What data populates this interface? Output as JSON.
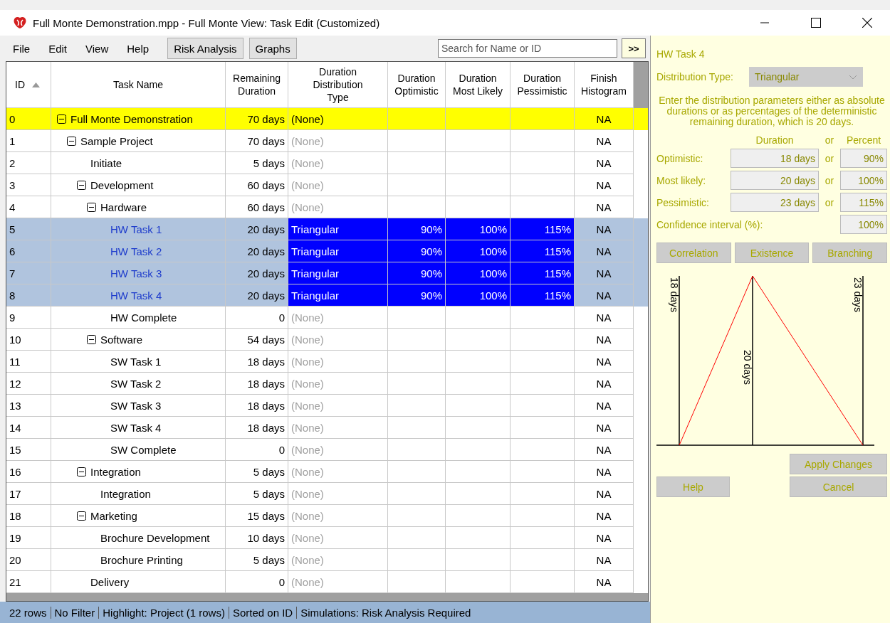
{
  "window": {
    "title": "Full Monte Demonstration.mpp - Full Monte View: Task Edit (Customized)"
  },
  "menu": [
    {
      "label": "File",
      "kind": "menu"
    },
    {
      "label": "Edit",
      "kind": "menu"
    },
    {
      "label": "View",
      "kind": "menu"
    },
    {
      "label": "Help",
      "kind": "menu"
    },
    {
      "label": "Risk Analysis",
      "kind": "button"
    },
    {
      "label": "Graphs",
      "kind": "button"
    }
  ],
  "search": {
    "placeholder": "Search for Name or ID"
  },
  "toggle_button": ">>",
  "table": {
    "columns": [
      {
        "label": "ID",
        "sorted": true
      },
      {
        "label": "Task Name",
        "sorted": false
      },
      {
        "label": "Remaining Duration",
        "sorted": false
      },
      {
        "label": "Duration Distribution Type",
        "sorted": false
      },
      {
        "label": "Duration Optimistic",
        "sorted": false
      },
      {
        "label": "Duration Most Likely",
        "sorted": false
      },
      {
        "label": "Duration Pessimistic",
        "sorted": false
      },
      {
        "label": "Finish Histogram",
        "sorted": false
      }
    ],
    "rows": [
      {
        "id": "0",
        "name": "Full Monte Demonstration",
        "remaining": "70 days",
        "distribution": "(None)",
        "dist_greyed": false,
        "optimistic": "",
        "likely": "",
        "pessimistic": "",
        "finish": "NA",
        "highlighted": true,
        "selected": false,
        "expanded": true,
        "children": [
          {
            "id": "1",
            "name": "Sample Project",
            "remaining": "70 days",
            "distribution": "(None)",
            "dist_greyed": true,
            "finish": "NA",
            "highlighted": false,
            "selected": false,
            "expanded": true,
            "children": [
              {
                "id": "2",
                "name": "Initiate",
                "remaining": "5 days",
                "distribution": "(None)",
                "dist_greyed": true,
                "finish": "NA",
                "highlighted": false,
                "selected": false
              },
              {
                "id": "3",
                "name": "Development",
                "remaining": "60 days",
                "distribution": "(None)",
                "dist_greyed": true,
                "finish": "NA",
                "highlighted": false,
                "selected": false,
                "expanded": true,
                "children": [
                  {
                    "id": "4",
                    "name": "Hardware",
                    "remaining": "60 days",
                    "distribution": "(None)",
                    "dist_greyed": true,
                    "finish": "NA",
                    "highlighted": false,
                    "selected": false,
                    "expanded": true,
                    "children": [
                      {
                        "id": "5",
                        "name": "HW Task 1",
                        "remaining": "20 days",
                        "distribution": "Triangular",
                        "optimistic": "90%",
                        "likely": "100%",
                        "pessimistic": "115%",
                        "finish": "NA",
                        "highlighted": false,
                        "selected": true
                      },
                      {
                        "id": "6",
                        "name": "HW Task 2",
                        "remaining": "20 days",
                        "distribution": "Triangular",
                        "optimistic": "90%",
                        "likely": "100%",
                        "pessimistic": "115%",
                        "finish": "NA",
                        "highlighted": false,
                        "selected": true
                      },
                      {
                        "id": "7",
                        "name": "HW Task 3",
                        "remaining": "20 days",
                        "distribution": "Triangular",
                        "optimistic": "90%",
                        "likely": "100%",
                        "pessimistic": "115%",
                        "finish": "NA",
                        "highlighted": false,
                        "selected": true
                      },
                      {
                        "id": "8",
                        "name": "HW Task 4",
                        "remaining": "20 days",
                        "distribution": "Triangular",
                        "optimistic": "90%",
                        "likely": "100%",
                        "pessimistic": "115%",
                        "finish": "NA",
                        "highlighted": false,
                        "selected": true
                      },
                      {
                        "id": "9",
                        "name": "HW Complete",
                        "remaining": "0",
                        "distribution": "(None)",
                        "dist_greyed": true,
                        "finish": "NA",
                        "highlighted": false,
                        "selected": false
                      }
                    ]
                  },
                  {
                    "id": "10",
                    "name": "Software",
                    "remaining": "54 days",
                    "distribution": "(None)",
                    "dist_greyed": true,
                    "finish": "NA",
                    "highlighted": false,
                    "selected": false,
                    "expanded": true,
                    "children": [
                      {
                        "id": "11",
                        "name": "SW Task 1",
                        "remaining": "18 days",
                        "distribution": "(None)",
                        "dist_greyed": true,
                        "finish": "NA",
                        "highlighted": false,
                        "selected": false
                      },
                      {
                        "id": "12",
                        "name": "SW Task 2",
                        "remaining": "18 days",
                        "distribution": "(None)",
                        "dist_greyed": true,
                        "finish": "NA",
                        "highlighted": false,
                        "selected": false
                      },
                      {
                        "id": "13",
                        "name": "SW Task 3",
                        "remaining": "18 days",
                        "distribution": "(None)",
                        "dist_greyed": true,
                        "finish": "NA",
                        "highlighted": false,
                        "selected": false
                      },
                      {
                        "id": "14",
                        "name": "SW Task 4",
                        "remaining": "18 days",
                        "distribution": "(None)",
                        "dist_greyed": true,
                        "finish": "NA",
                        "highlighted": false,
                        "selected": false
                      },
                      {
                        "id": "15",
                        "name": "SW Complete",
                        "remaining": "0",
                        "distribution": "(None)",
                        "dist_greyed": true,
                        "finish": "NA",
                        "highlighted": false,
                        "selected": false
                      }
                    ]
                  }
                ]
              },
              {
                "id": "16",
                "name": "Integration",
                "remaining": "5 days",
                "distribution": "(None)",
                "dist_greyed": true,
                "finish": "NA",
                "highlighted": false,
                "selected": false,
                "expanded": true,
                "children": [
                  {
                    "id": "17",
                    "name": "Integration",
                    "remaining": "5 days",
                    "distribution": "(None)",
                    "dist_greyed": true,
                    "finish": "NA",
                    "highlighted": false,
                    "selected": false
                  }
                ]
              },
              {
                "id": "18",
                "name": "Marketing",
                "remaining": "15 days",
                "distribution": "(None)",
                "dist_greyed": true,
                "finish": "NA",
                "highlighted": false,
                "selected": false,
                "expanded": true,
                "children": [
                  {
                    "id": "19",
                    "name": "Brochure Development",
                    "remaining": "10 days",
                    "distribution": "(None)",
                    "dist_greyed": true,
                    "finish": "NA",
                    "highlighted": false,
                    "selected": false
                  },
                  {
                    "id": "20",
                    "name": "Brochure Printing",
                    "remaining": "5 days",
                    "distribution": "(None)",
                    "dist_greyed": true,
                    "finish": "NA",
                    "highlighted": false,
                    "selected": false
                  }
                ]
              },
              {
                "id": "21",
                "name": "Delivery",
                "remaining": "0",
                "distribution": "(None)",
                "dist_greyed": true,
                "finish": "NA",
                "highlighted": false,
                "selected": false
              }
            ]
          }
        ]
      }
    ]
  },
  "status_bar": [
    "22 rows",
    "No Filter",
    "Highlight: Project (1 rows)",
    "Sorted on ID",
    "Simulations: Risk Analysis Required"
  ],
  "panel": {
    "task": "HW Task 4",
    "distribution_label": "Distribution Type:",
    "distribution_value": "Triangular",
    "instructions": "Enter the distribution parameters either as absolute durations or as percentages of the deterministic remaining duration, which is 20 days.",
    "duration_heading": "Duration",
    "or_heading": "or",
    "percent_heading": "Percent",
    "params": [
      {
        "label": "Optimistic:",
        "duration": "18 days",
        "or": "or",
        "percent": "90%"
      },
      {
        "label": "Most likely:",
        "duration": "20 days",
        "or": "or",
        "percent": "100%"
      },
      {
        "label": "Pessimistic:",
        "duration": "23 days",
        "or": "or",
        "percent": "115%"
      }
    ],
    "confidence": {
      "label": "Confidence interval (%):",
      "value": "100%"
    },
    "buttons": [
      "Correlation",
      "Existence",
      "Branching"
    ],
    "graph_labels": [
      "18 days",
      "20 days",
      "23 days"
    ],
    "apply": "Apply Changes",
    "help": "Help",
    "cancel": "Cancel"
  }
}
